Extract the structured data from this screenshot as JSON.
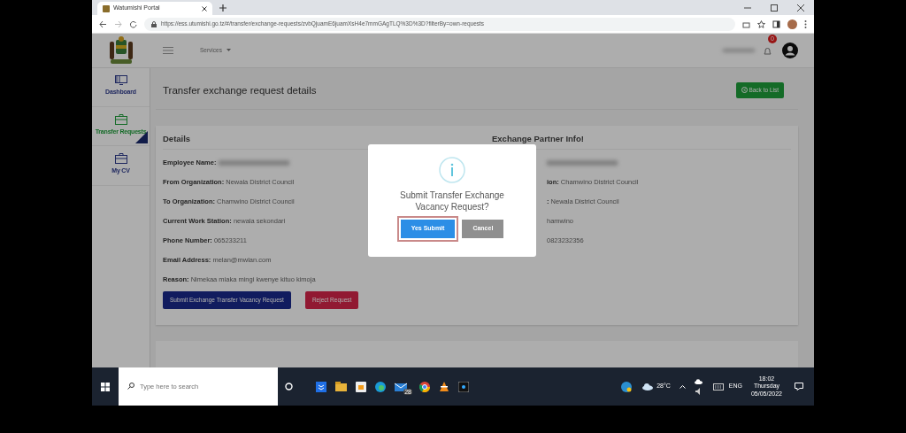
{
  "browser": {
    "tab_title": "Watumishi Portal",
    "url": "https://ess.utumishi.go.tz/#/transfer/exchange-requests/zvbQjuamE6juamXsH4e7mmGAgTLQ%3D%3D?filterBy=own-requests"
  },
  "header": {
    "menu": "Services",
    "notification_count": "0"
  },
  "sidebar": [
    {
      "label": "Dashboard",
      "selected": false
    },
    {
      "label": "Transfer Requests",
      "selected": true
    },
    {
      "label": "My CV",
      "selected": false
    }
  ],
  "page": {
    "title": "Transfer exchange request details",
    "back_button": "Back to List"
  },
  "details": {
    "heading": "Details",
    "fields": [
      {
        "kind": "blurred",
        "label": "Employee Name:"
      },
      {
        "kind": "text",
        "label": "From Organization:",
        "value": "Newala District Council"
      },
      {
        "kind": "text",
        "label": "To Organization:",
        "value": "Chamwino District Council"
      },
      {
        "kind": "text",
        "label": "Current Work Station:",
        "value": "newala sekondari"
      },
      {
        "kind": "text",
        "label": "Phone Number:",
        "value": "065233211"
      },
      {
        "kind": "text",
        "label": "Email Address:",
        "value": "melan@mwlan.com"
      },
      {
        "kind": "text",
        "label": "Reason:",
        "value": "Nimekaa miaka mingi kwenye kituo kimoja"
      }
    ],
    "submit_button": "Submit Exchange Transfer Vacancy Request",
    "reject_button": "Reject Request"
  },
  "partner": {
    "heading": "Exchange Partner Info!",
    "fields": [
      {
        "kind": "blurred"
      },
      {
        "kind": "text",
        "label": "ion:",
        "value": "Chamwino District Council"
      },
      {
        "kind": "text",
        "label": ":",
        "value": "Newala District Council"
      },
      {
        "kind": "text",
        "value": "hamwino"
      },
      {
        "kind": "text",
        "value": "0823232356"
      }
    ]
  },
  "modal": {
    "title": "Submit Transfer Exchange Vacancy Request?",
    "confirm_button": "Yes Submit",
    "cancel_button": "Cancel"
  },
  "taskbar": {
    "search_placeholder": "Type here to search",
    "mail_badge": "28",
    "weather": "28°C",
    "language": "ENG",
    "time": "18:02",
    "day": "Thursday",
    "date": "05/05/2022"
  }
}
